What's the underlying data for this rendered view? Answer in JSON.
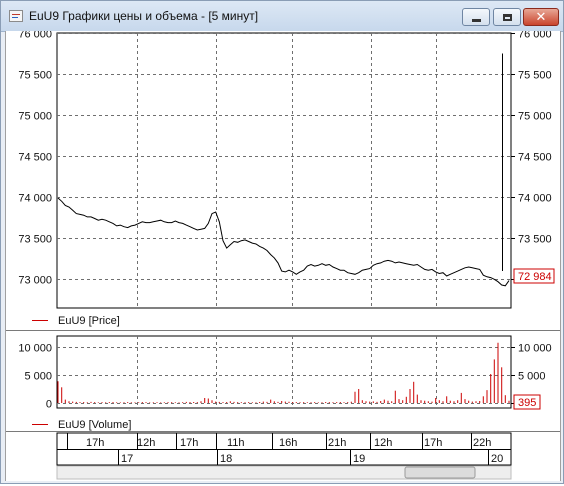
{
  "window": {
    "title": "EuU9 Графики цены и объема - [5 минут]",
    "buttons": {
      "minimize": "minimize",
      "maximize": "maximize",
      "close": "close"
    }
  },
  "colors": {
    "price_line": "#000000",
    "volume_bars": "#cc0000",
    "legend_marker": "#cc0000",
    "grid": "#6f6f6f",
    "last_label": "#cc0000"
  },
  "chart_data": [
    {
      "type": "line",
      "legend": "EuU9 [Price]",
      "ylim": [
        72650,
        76000
      ],
      "y_ticks": [
        "73 000",
        "73 500",
        "74 000",
        "74 500",
        "75 000",
        "75 500",
        "76 000"
      ],
      "y_tick_values": [
        73000,
        73500,
        74000,
        74500,
        75000,
        75500,
        76000
      ],
      "last_value_label": "72 984",
      "grid": true,
      "series": [
        {
          "values": [
            73990,
            73950,
            73900,
            73880,
            73840,
            73800,
            73790,
            73780,
            73760,
            73760,
            73740,
            73720,
            73730,
            73720,
            73700,
            73680,
            73650,
            73660,
            73640,
            73630,
            73650,
            73660,
            73680,
            73700,
            73690,
            73690,
            73700,
            73710,
            73720,
            73700,
            73690,
            73690,
            73710,
            73690,
            73680,
            73660,
            73640,
            73620,
            73600,
            73610,
            73620,
            73680,
            73800,
            73820,
            73700,
            73470,
            73380,
            73420,
            73460,
            73450,
            73470,
            73480,
            73460,
            73440,
            73430,
            73400,
            73380,
            73350,
            73300,
            73260,
            73200,
            73100,
            73090,
            73110,
            73090,
            73060,
            73090,
            73110,
            73160,
            73180,
            73160,
            73170,
            73190,
            73170,
            73180,
            73150,
            73130,
            73110,
            73110,
            73080,
            73070,
            73060,
            73080,
            73110,
            73120,
            73130,
            73170,
            73190,
            73200,
            73220,
            73230,
            73220,
            73200,
            73210,
            73200,
            73190,
            73180,
            73170,
            73180,
            73150,
            73120,
            73110,
            73120,
            73090,
            73070,
            73080,
            73040,
            73060,
            73080,
            73100,
            73120,
            73140,
            73150,
            73140,
            73130,
            73120,
            73050,
            73030,
            73020,
            73000,
            72970,
            72930,
            72920,
            72984
          ]
        }
      ],
      "spike": {
        "from": 73100,
        "to": 75750
      }
    },
    {
      "type": "bar",
      "legend": "EuU9 [Volume]",
      "ylim": [
        -900,
        12000
      ],
      "y_ticks": [
        "0",
        "5 000",
        "10 000"
      ],
      "y_tick_values": [
        0,
        5000,
        10000
      ],
      "last_value_label": "395",
      "grid": true,
      "series": [
        {
          "values": [
            3900,
            2800,
            600,
            300,
            250,
            200,
            150,
            180,
            120,
            200,
            150,
            100,
            160,
            120,
            150,
            180,
            130,
            110,
            140,
            160,
            120,
            100,
            130,
            170,
            150,
            110,
            120,
            140,
            100,
            130,
            160,
            150,
            120,
            110,
            140,
            200,
            180,
            170,
            150,
            300,
            900,
            800,
            500,
            250,
            200,
            150,
            180,
            300,
            200,
            160,
            140,
            120,
            150,
            130,
            110,
            170,
            250,
            200,
            600,
            300,
            200,
            350,
            250,
            220,
            180,
            150,
            140,
            160,
            120,
            130,
            150,
            110,
            140,
            180,
            160,
            130,
            150,
            170,
            140,
            160,
            220,
            2000,
            2500,
            500,
            300,
            250,
            280,
            200,
            350,
            600,
            400,
            300,
            2200,
            700,
            500,
            1100,
            2500,
            3800,
            1500,
            500,
            400,
            300,
            250,
            900,
            500,
            300,
            1200,
            400,
            300,
            500,
            1800,
            700,
            400,
            250,
            300,
            350,
            1200,
            2300,
            5200,
            7800,
            10800,
            6400,
            1400,
            395
          ]
        }
      ]
    }
  ],
  "time_axis": {
    "hours": [
      "17h",
      "12h",
      "17h",
      "11h",
      "16h",
      "21h",
      "12h",
      "17h",
      "22h"
    ],
    "days": [
      "17",
      "18",
      "19",
      "20"
    ]
  }
}
